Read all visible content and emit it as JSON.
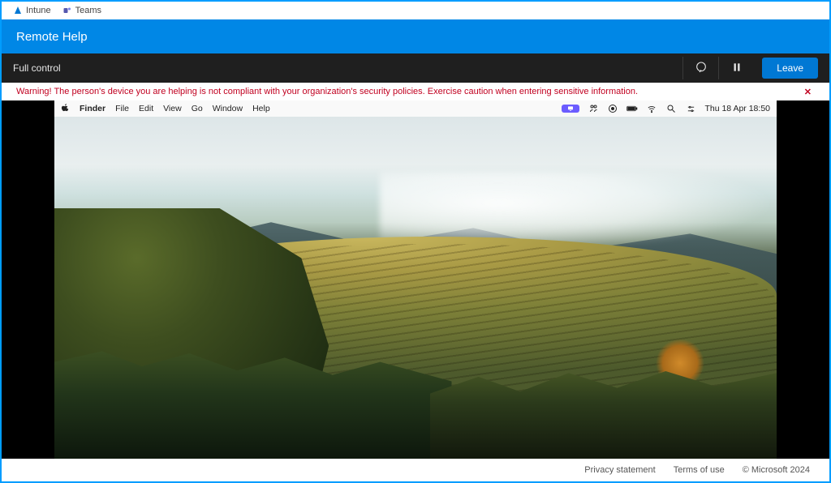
{
  "top_tabs": {
    "intune": "Intune",
    "teams": "Teams"
  },
  "app": {
    "title": "Remote Help"
  },
  "controlbar": {
    "mode": "Full control",
    "leave": "Leave"
  },
  "warning": {
    "text": "Warning! The person's device you are helping is not compliant with your organization's security policies. Exercise caution when entering sensitive information."
  },
  "mac": {
    "app_name": "Finder",
    "menus": [
      "File",
      "Edit",
      "View",
      "Go",
      "Window",
      "Help"
    ],
    "datetime": "Thu 18 Apr  18:50"
  },
  "footer": {
    "privacy": "Privacy statement",
    "terms": "Terms of use",
    "copyright": "© Microsoft 2024"
  }
}
